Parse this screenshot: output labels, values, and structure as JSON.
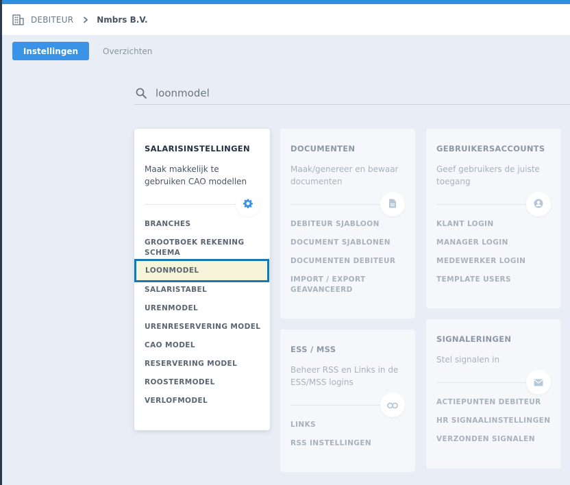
{
  "breadcrumb": {
    "root": "DEBITEUR",
    "company": "Nmbrs B.V."
  },
  "tabs": [
    {
      "label": "Instellingen",
      "active": true
    },
    {
      "label": "Overzichten",
      "active": false
    }
  ],
  "search": {
    "value": "loonmodel"
  },
  "colors": {
    "accent": "#3a93e6",
    "highlight_border": "#1776b5",
    "highlight_fill": "#f6f4d9"
  },
  "cards": {
    "salaris": {
      "title": "SALARISINSTELLINGEN",
      "desc": "Maak makkelijk te gebruiken CAO modellen",
      "icon": "gear-icon",
      "links": [
        "BRANCHES",
        "GROOTBOEK REKENING SCHEMA",
        "LOONMODEL",
        "SALARISTABEL",
        "URENMODEL",
        "URENRESERVERING MODEL",
        "CAO MODEL",
        "RESERVERING MODEL",
        "ROOSTERMODEL",
        "VERLOFMODEL"
      ],
      "highlighted": "LOONMODEL"
    },
    "documenten": {
      "title": "DOCUMENTEN",
      "desc": "Maak/genereer en bewaar documenten",
      "icon": "document-icon",
      "links": [
        "DEBITEUR SJABLOON",
        "DOCUMENT SJABLONEN",
        "DOCUMENTEN DEBITEUR",
        "IMPORT / EXPORT GEAVANCEERD"
      ]
    },
    "gebruikers": {
      "title": "GEBRUIKERSACCOUNTS",
      "desc": "Geef gebruikers de juiste toegang",
      "icon": "user-icon",
      "links": [
        "KLANT LOGIN",
        "MANAGER LOGIN",
        "MEDEWERKER LOGIN",
        "TEMPLATE USERS"
      ]
    },
    "ess": {
      "title": "ESS / MSS",
      "desc": "Beheer RSS en Links in de ESS/MSS logins",
      "icon": "link-icon",
      "links": [
        "LINKS",
        "RSS INSTELLINGEN"
      ]
    },
    "signaleringen": {
      "title": "SIGNALERINGEN",
      "desc": "Stel signalen in",
      "icon": "envelope-icon",
      "links": [
        "ACTIEPUNTEN DEBITEUR",
        "HR SIGNAALINSTELLINGEN",
        "VERZONDEN SIGNALEN"
      ]
    }
  }
}
